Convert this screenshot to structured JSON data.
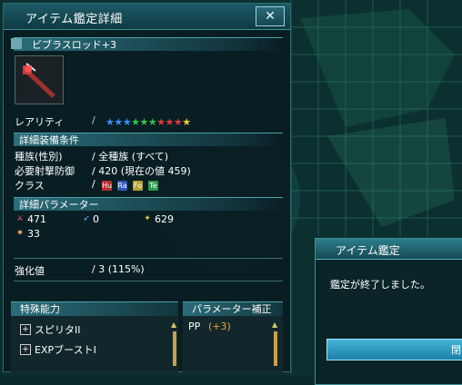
{
  "window": {
    "title": "アイテム鑑定詳細",
    "close_glyph": "✕",
    "item_name": "ビブラスロッド+3"
  },
  "rarity": {
    "label": "レアリティ",
    "separator": "/",
    "stars_blue": "★★★",
    "stars_green": "★★★",
    "stars_red": "★★★",
    "stars_yellow": "★"
  },
  "equip": {
    "section": "詳細装備条件",
    "race_label": "種族(性別)",
    "race_value": "/ 全種族 (すべて)",
    "def_label": "必要射撃防御",
    "def_value": "/ 420 (現在の値 459)",
    "class_label": "クラス",
    "class_sep": "/",
    "classes": [
      "Hu",
      "Ra",
      "Fo",
      "Te"
    ]
  },
  "params": {
    "section": "詳細パラメーター",
    "atk": "471",
    "shoot": "0",
    "tech": "629",
    "dex": "33"
  },
  "grind": {
    "label": "強化値",
    "value": "/ 3 (115%)"
  },
  "abilities": {
    "section": "特殊能力",
    "items": [
      "スピリタII",
      "EXPブーストI"
    ],
    "expand_glyph": "+"
  },
  "param_bonus": {
    "section": "パラメーター補正",
    "stat": "PP",
    "value": "(+3)"
  },
  "dialog": {
    "title": "アイテム鑑定",
    "message": "鑑定が終了しました。",
    "ok_label": "閉"
  }
}
